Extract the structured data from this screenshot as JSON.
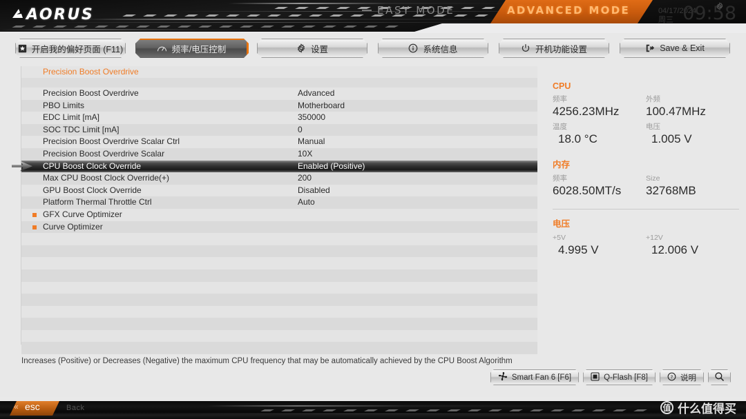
{
  "header": {
    "brand": "AORUS",
    "easy_mode": "EASY MODE",
    "advanced_mode": "ADVANCED MODE",
    "date": "04/17/2024",
    "weekday": "周三",
    "time": "09:58",
    "gear_icon": "gear-icon"
  },
  "nav": {
    "tabs": [
      {
        "label": "开启我的偏好页面 (F11)",
        "icon": "favorite-star-icon",
        "active": false
      },
      {
        "label": "频率/电压控制",
        "icon": "gauge-icon",
        "active": true
      },
      {
        "label": "设置",
        "icon": "gear-icon",
        "active": false
      },
      {
        "label": "系统信息",
        "icon": "info-icon",
        "active": false
      },
      {
        "label": "开机功能设置",
        "icon": "power-icon",
        "active": false
      },
      {
        "label": "Save & Exit",
        "icon": "exit-icon",
        "active": false
      }
    ]
  },
  "main": {
    "section_title": "Precision Boost Overdrive",
    "rows": [
      {
        "label": "Precision Boost Overdrive",
        "value": "Advanced",
        "submenu": false,
        "selected": false
      },
      {
        "label": "PBO Limits",
        "value": "Motherboard",
        "submenu": false,
        "selected": false
      },
      {
        "label": "EDC Limit [mA]",
        "value": "350000",
        "submenu": false,
        "selected": false
      },
      {
        "label": "SOC TDC Limit [mA]",
        "value": "0",
        "submenu": false,
        "selected": false
      },
      {
        "label": "Precision Boost Overdrive Scalar Ctrl",
        "value": "Manual",
        "submenu": false,
        "selected": false
      },
      {
        "label": "Precision Boost Overdrive Scalar",
        "value": "10X",
        "submenu": false,
        "selected": false
      },
      {
        "label": "CPU Boost Clock Override",
        "value": "Enabled (Positive)",
        "submenu": false,
        "selected": true
      },
      {
        "label": "Max CPU Boost Clock Override(+)",
        "value": "200",
        "submenu": false,
        "selected": false
      },
      {
        "label": "GPU Boost Clock Override",
        "value": "Disabled",
        "submenu": false,
        "selected": false
      },
      {
        "label": "Platform Thermal Throttle Ctrl",
        "value": "Auto",
        "submenu": false,
        "selected": false
      },
      {
        "label": "GFX Curve Optimizer",
        "value": "",
        "submenu": true,
        "selected": false
      },
      {
        "label": "Curve Optimizer",
        "value": "",
        "submenu": true,
        "selected": false
      }
    ],
    "empty_row_count": 10
  },
  "info": {
    "cpu": {
      "title": "CPU",
      "freq_key": "频率",
      "freq_val": "4256.23MHz",
      "bclk_key": "外频",
      "bclk_val": "100.47MHz",
      "temp_key": "温度",
      "temp_val": "18.0 °C",
      "volt_key": "电压",
      "volt_val": "1.005 V"
    },
    "memory": {
      "title": "内存",
      "freq_key": "频率",
      "freq_val": "6028.50MT/s",
      "size_key": "Size",
      "size_val": "32768MB"
    },
    "voltage": {
      "title": "电压",
      "v5_key": "+5V",
      "v5_val": "4.995 V",
      "v12_key": "+12V",
      "v12_val": "12.006 V"
    }
  },
  "footer": {
    "help_text": "Increases (Positive) or Decreases (Negative) the maximum CPU frequency that may be automatically achieved by the CPU Boost Algorithm",
    "buttons": [
      {
        "label": "Smart Fan 6 [F6]",
        "icon": "fan-icon"
      },
      {
        "label": "Q-Flash [F8]",
        "icon": "chip-icon"
      },
      {
        "label": "说明",
        "icon": "question-icon"
      }
    ],
    "search_icon": "search-icon",
    "esc_label": "esc",
    "esc_chevron": "«",
    "back_label": "Back",
    "watermark_mark": "值",
    "watermark_text": "什么值得买"
  },
  "colors": {
    "accent": "#f07c26",
    "advanced_tab": "#c85a0d",
    "panel_bg": "#e2e2e2"
  }
}
